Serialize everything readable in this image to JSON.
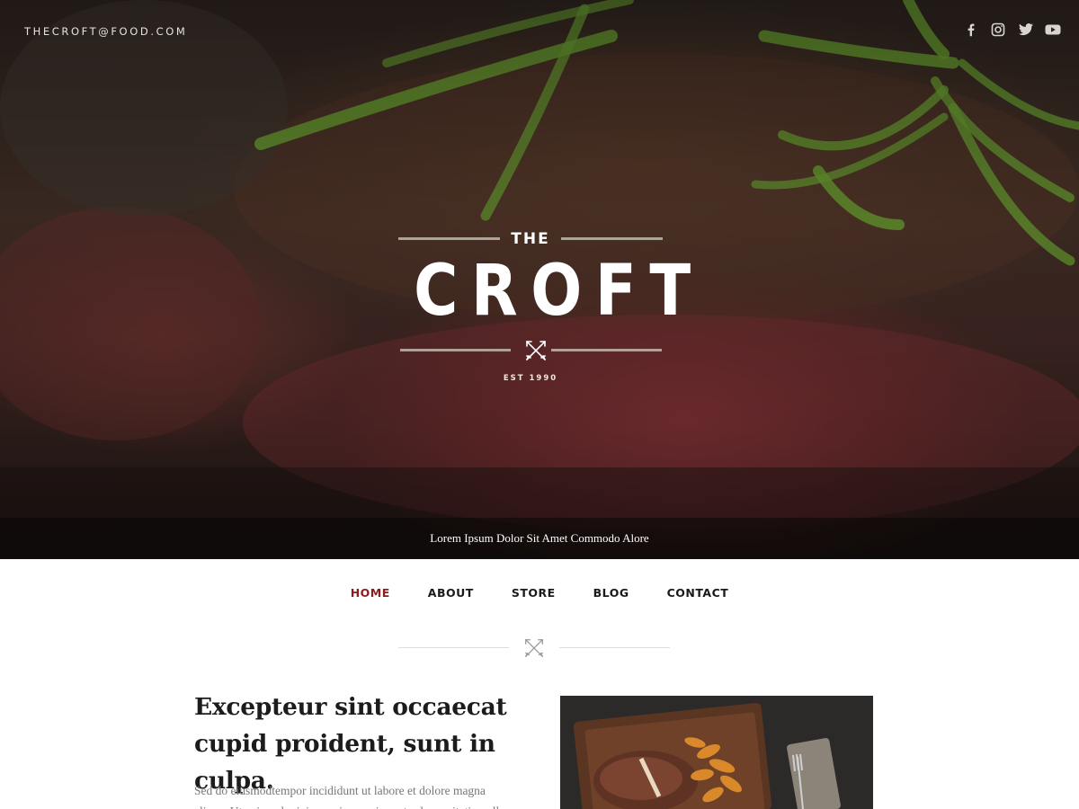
{
  "header": {
    "email": "THECROFT@FOOD.COM",
    "social_icons": [
      "facebook-icon",
      "instagram-icon",
      "twitter-icon",
      "youtube-icon"
    ]
  },
  "logo": {
    "the": "THE",
    "name": "CROFT",
    "est": "EST 1990",
    "emblem": "crossed-arrows-icon"
  },
  "hero": {
    "tagline": "Lorem Ipsum Dolor Sit Amet Commodo Alore"
  },
  "nav": {
    "items": [
      {
        "label": "HOME",
        "active": true
      },
      {
        "label": "ABOUT",
        "active": false
      },
      {
        "label": "STORE",
        "active": false
      },
      {
        "label": "BLOG",
        "active": false
      },
      {
        "label": "CONTACT",
        "active": false
      }
    ]
  },
  "content": {
    "headline": "Excepteur sint occaecat cupid proident, sunt in culpa.",
    "body": "Sed do eiusmodtempor incididunt ut labore et dolore magna aliqua. Ut enim ad minim veniam, quis nostrud exercitation ulla"
  },
  "colors": {
    "accent": "#8e1c1c",
    "text": "#1a1a1a",
    "muted": "#777777"
  }
}
